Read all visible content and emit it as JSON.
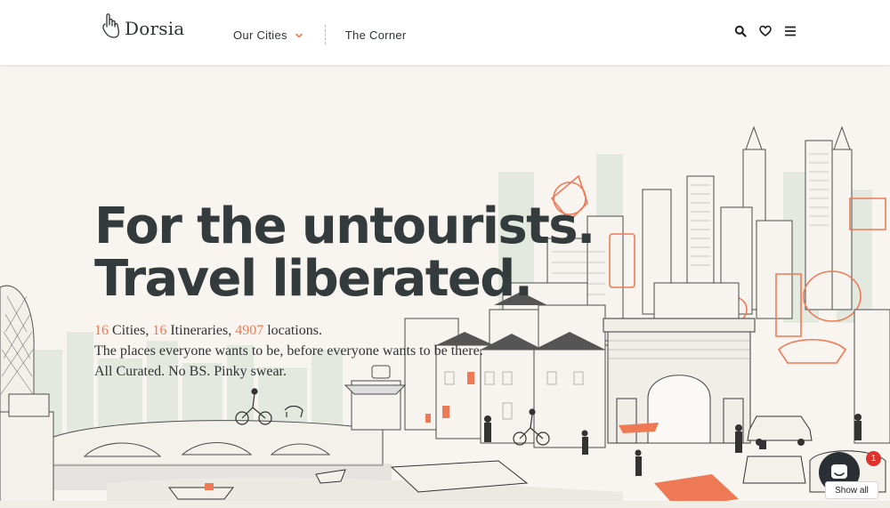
{
  "brand": {
    "name": "Dorsia",
    "logo_icon": "hand-icon"
  },
  "nav": {
    "cities_label": "Our Cities",
    "corner_label": "The Corner"
  },
  "header_icons": [
    "search-icon",
    "heart-icon",
    "menu-icon"
  ],
  "hero": {
    "headline_line1": "For the untourists.",
    "headline_line2": "Travel liberated.",
    "cities_count": "16",
    "cities_label": " Cities, ",
    "itineraries_count": "16",
    "itineraries_label": " Itineraries, ",
    "locations_count": "4907",
    "locations_label": " locations.",
    "tagline": "The places everyone wants to be, before everyone wants to be there. All Curated. No BS. Pinky swear."
  },
  "chat": {
    "badge_count": "1",
    "show_all_label": "Show all"
  },
  "colors": {
    "accent": "#ee7a55",
    "text": "#343b3d",
    "background": "#f8f4ef",
    "skyline_tint": "#dfe6dc"
  }
}
